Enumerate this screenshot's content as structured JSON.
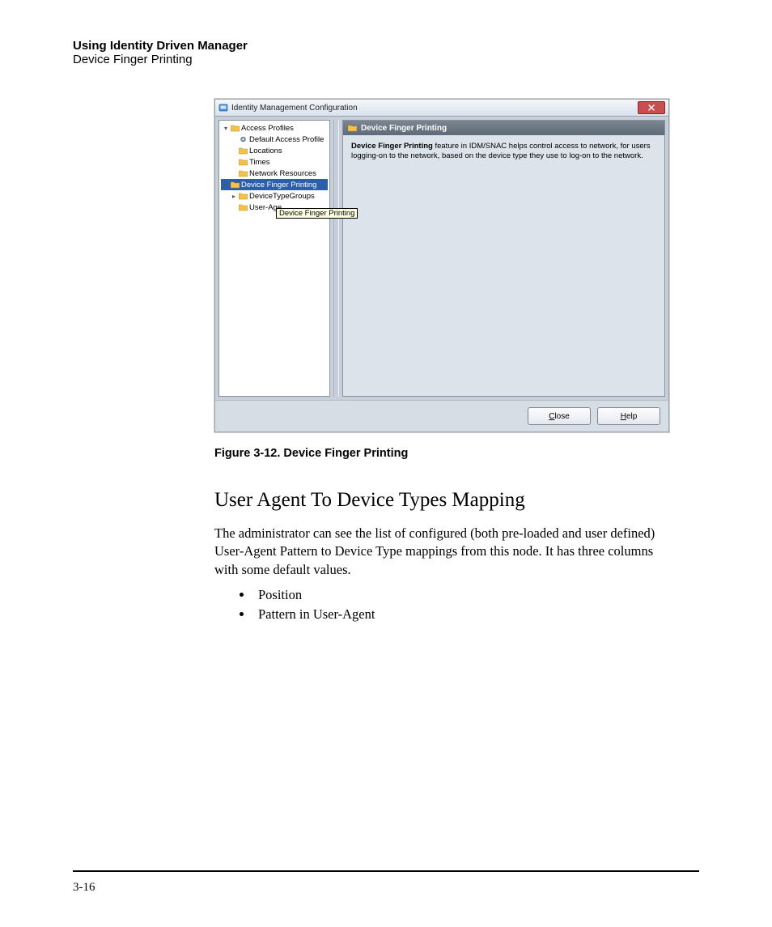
{
  "header": {
    "title": "Using Identity Driven Manager",
    "subtitle": "Device Finger Printing"
  },
  "dialog": {
    "title": "Identity Management Configuration",
    "tree": {
      "access_profiles": "Access Profiles",
      "default_access_profile": "Default Access Profile",
      "locations": "Locations",
      "times": "Times",
      "network_resources": "Network Resources",
      "device_finger_printing": "Device Finger Printing",
      "device_type_groups": "DeviceTypeGroups",
      "user_agent_partial": "User-Age"
    },
    "tooltip": "Device Finger Printing",
    "detail": {
      "heading": "Device Finger Printing",
      "text_bold": "Device Finger Printing",
      "text_rest": " feature in IDM/SNAC helps control access to network, for users logging-on to the network, based on the device type they use to log-on to the network."
    },
    "buttons": {
      "close": "Close",
      "help": "Help"
    }
  },
  "caption": "Figure 3-12. Device Finger Printing",
  "section_heading": "User Agent To Device Types Mapping",
  "body_para": "The administrator can see the list of configured (both pre-loaded and user defined) User-Agent Pattern to Device Type mappings from this node. It has three columns with some default values.",
  "bullets": {
    "b1": "Position",
    "b2": "Pattern in User-Agent"
  },
  "page_number": "3-16"
}
